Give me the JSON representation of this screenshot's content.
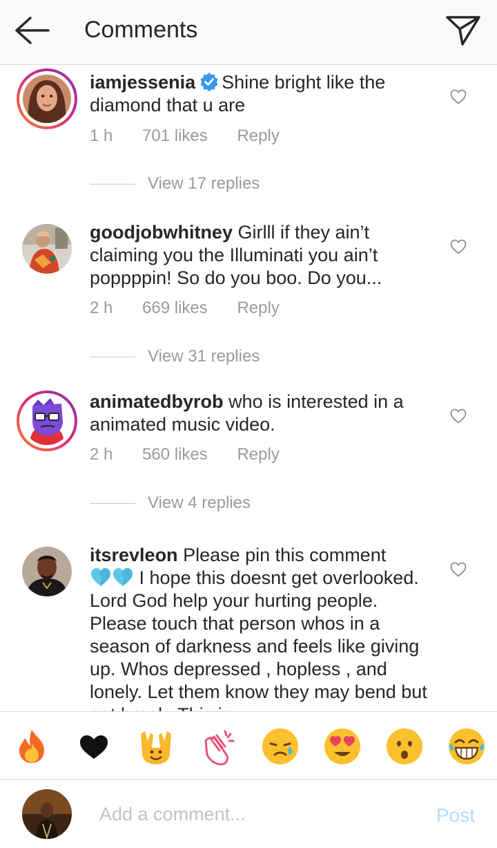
{
  "header": {
    "title": "Comments"
  },
  "comments": [
    {
      "username": "iamjessenia",
      "verified": true,
      "text": "Shine bright like the diamond that u are",
      "time": "1 h",
      "likes": "701 likes",
      "reply": "Reply",
      "view_replies": "View 17 replies"
    },
    {
      "username": "goodjobwhitney",
      "verified": false,
      "text": "Girlll if they ain’t claiming you the Illuminati you ain’t poppppin! So do you boo. Do you...",
      "time": "2 h",
      "likes": "669 likes",
      "reply": "Reply",
      "view_replies": "View 31 replies"
    },
    {
      "username": "animatedbyrob",
      "verified": false,
      "text": "who is interested in a animated music video.",
      "time": "2 h",
      "likes": "560 likes",
      "reply": "Reply",
      "view_replies": "View 4 replies"
    },
    {
      "username": "itsrevleon",
      "verified": false,
      "text_before_emoji": "Please pin this comment",
      "text_after_emoji": "I hope this doesnt get overlooked. Lord God help your hurting people. Please touch that person whos in a season of darkness and feels like giving up. Whos depressed , hopless , and lonely. Let them know they may bend but not break. This is..."
    }
  ],
  "emoji_bar": [
    "fire-emoji",
    "black-heart-emoji",
    "raised-hands-emoji",
    "clapping-hands-emoji",
    "crying-face-emoji",
    "heart-eyes-emoji",
    "surprised-face-emoji",
    "laughing-tears-emoji"
  ],
  "composer": {
    "placeholder": "Add a comment...",
    "post_label": "Post"
  },
  "colors": {
    "header_bg": "#fafafa",
    "meta_text": "#9a9a9a",
    "verified_blue": "#3897f0",
    "post_disabled": "#b3dbff",
    "story_ring_start": "#f58529",
    "story_ring_end": "#8134af"
  }
}
